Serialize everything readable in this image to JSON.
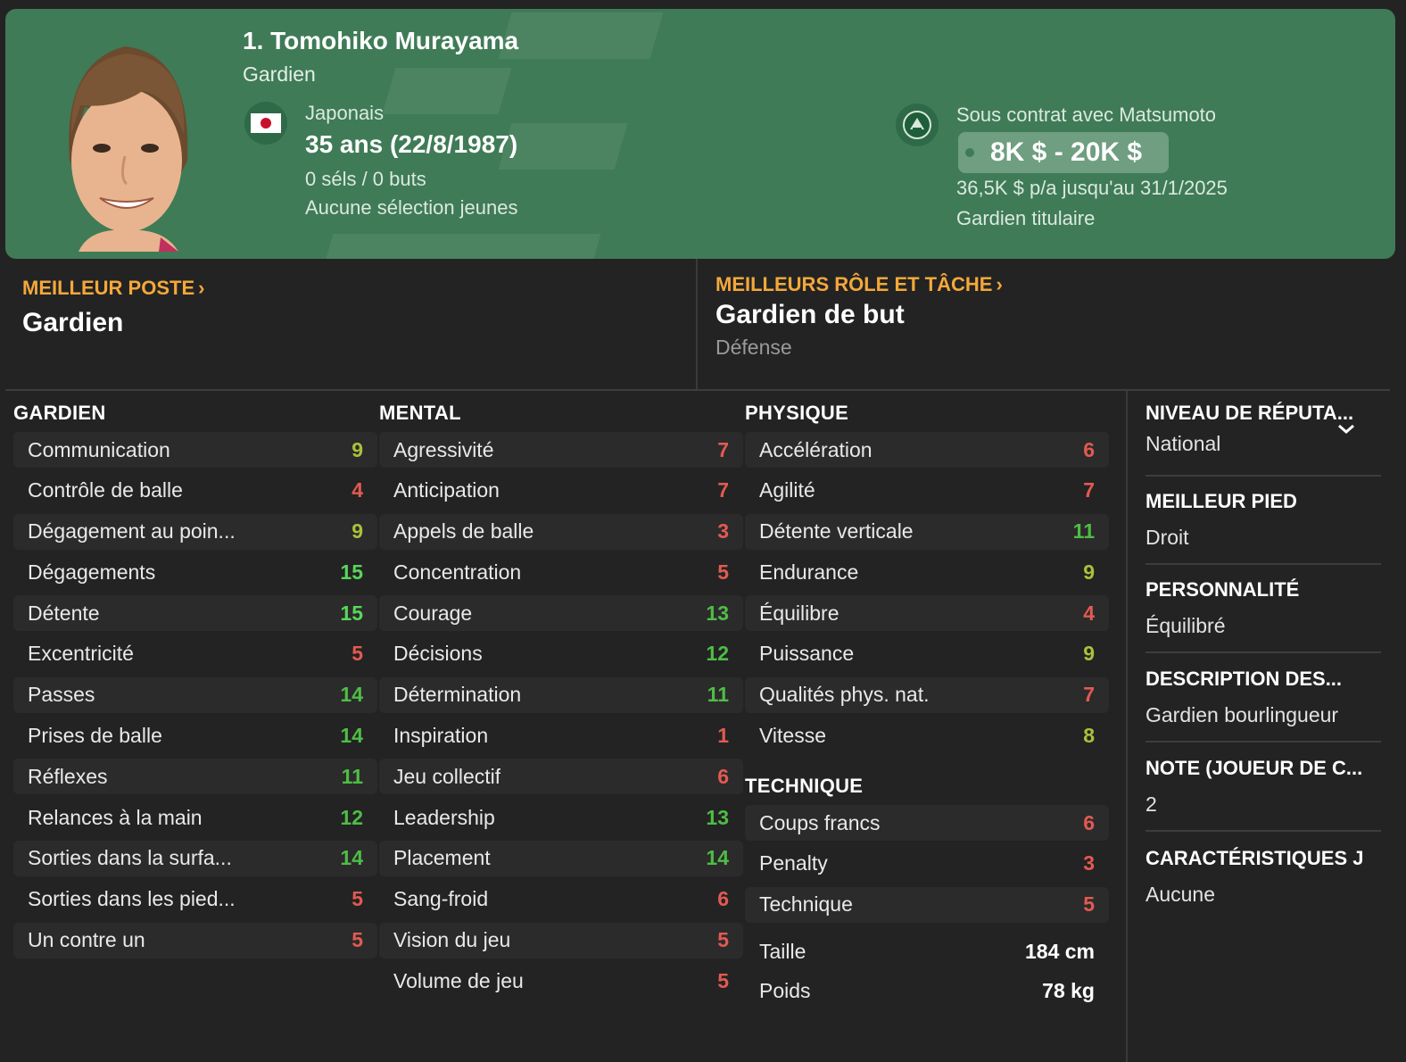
{
  "header": {
    "name": "1. Tomohiko Murayama",
    "position": "Gardien",
    "nationality": "Japonais",
    "age": "35 ans (22/8/1987)",
    "caps": "0 séls / 0 buts",
    "youth": "Aucune sélection jeunes",
    "contract": "Sous contrat avec Matsumoto",
    "wage_range": "8K $ - 20K $",
    "wage_annual": "36,5K $ p/a jusqu'au 31/1/2025",
    "squad_status": "Gardien titulaire",
    "flag_icon": "japan-flag-icon",
    "club_icon": "matsumoto-badge-icon"
  },
  "best_position": {
    "heading": "MEILLEUR POSTE",
    "value": "Gardien"
  },
  "best_role": {
    "heading": "MEILLEURS RÔLE ET TÂCHE",
    "value": "Gardien de but",
    "duty": "Défense"
  },
  "colors": {
    "header_bg": "#3f7b57",
    "accent": "#f4a83a",
    "low": "#e25a52",
    "mid": "#a9c23a",
    "good": "#4fbd45",
    "high": "#58d65a"
  },
  "goalkeeping": {
    "title": "GARDIEN",
    "rows": [
      {
        "name": "Communication",
        "value": "9",
        "tier": "olive"
      },
      {
        "name": "Contrôle de balle",
        "value": "4",
        "tier": "red"
      },
      {
        "name": "Dégagement au poin...",
        "value": "9",
        "tier": "olive"
      },
      {
        "name": "Dégagements",
        "value": "15",
        "tier": "bright"
      },
      {
        "name": "Détente",
        "value": "15",
        "tier": "bright"
      },
      {
        "name": "Excentricité",
        "value": "5",
        "tier": "red"
      },
      {
        "name": "Passes",
        "value": "14",
        "tier": "green"
      },
      {
        "name": "Prises de balle",
        "value": "14",
        "tier": "green"
      },
      {
        "name": "Réflexes",
        "value": "11",
        "tier": "green"
      },
      {
        "name": "Relances à la main",
        "value": "12",
        "tier": "green"
      },
      {
        "name": "Sorties dans la surfa...",
        "value": "14",
        "tier": "green"
      },
      {
        "name": "Sorties dans les pied...",
        "value": "5",
        "tier": "red"
      },
      {
        "name": "Un contre un",
        "value": "5",
        "tier": "red"
      }
    ]
  },
  "mental": {
    "title": "MENTAL",
    "rows": [
      {
        "name": "Agressivité",
        "value": "7",
        "tier": "red"
      },
      {
        "name": "Anticipation",
        "value": "7",
        "tier": "red"
      },
      {
        "name": "Appels de balle",
        "value": "3",
        "tier": "red"
      },
      {
        "name": "Concentration",
        "value": "5",
        "tier": "red"
      },
      {
        "name": "Courage",
        "value": "13",
        "tier": "green"
      },
      {
        "name": "Décisions",
        "value": "12",
        "tier": "green"
      },
      {
        "name": "Détermination",
        "value": "11",
        "tier": "green"
      },
      {
        "name": "Inspiration",
        "value": "1",
        "tier": "red"
      },
      {
        "name": "Jeu collectif",
        "value": "6",
        "tier": "red"
      },
      {
        "name": "Leadership",
        "value": "13",
        "tier": "green"
      },
      {
        "name": "Placement",
        "value": "14",
        "tier": "green"
      },
      {
        "name": "Sang-froid",
        "value": "6",
        "tier": "red"
      },
      {
        "name": "Vision du jeu",
        "value": "5",
        "tier": "red"
      },
      {
        "name": "Volume de jeu",
        "value": "5",
        "tier": "red"
      }
    ]
  },
  "physical": {
    "title": "PHYSIQUE",
    "rows": [
      {
        "name": "Accélération",
        "value": "6",
        "tier": "red"
      },
      {
        "name": "Agilité",
        "value": "7",
        "tier": "red"
      },
      {
        "name": "Détente verticale",
        "value": "11",
        "tier": "green"
      },
      {
        "name": "Endurance",
        "value": "9",
        "tier": "olive"
      },
      {
        "name": "Équilibre",
        "value": "4",
        "tier": "red"
      },
      {
        "name": "Puissance",
        "value": "9",
        "tier": "olive"
      },
      {
        "name": "Qualités phys. nat.",
        "value": "7",
        "tier": "red"
      },
      {
        "name": "Vitesse",
        "value": "8",
        "tier": "olive"
      }
    ]
  },
  "technical": {
    "title": "TECHNIQUE",
    "rows": [
      {
        "name": "Coups francs",
        "value": "6",
        "tier": "red"
      },
      {
        "name": "Penalty",
        "value": "3",
        "tier": "red"
      },
      {
        "name": "Technique",
        "value": "5",
        "tier": "red"
      }
    ]
  },
  "measures": [
    {
      "name": "Taille",
      "value": "184 cm"
    },
    {
      "name": "Poids",
      "value": "78 kg"
    }
  ],
  "info": [
    {
      "title": "NIVEAU DE RÉPUTA...",
      "value": "National"
    },
    {
      "title": "MEILLEUR PIED",
      "value": "Droit"
    },
    {
      "title": "PERSONNALITÉ",
      "value": "Équilibré"
    },
    {
      "title": "DESCRIPTION DES...",
      "value": "Gardien bourlingueur"
    },
    {
      "title": "NOTE (JOUEUR DE C...",
      "value": "2"
    },
    {
      "title": "CARACTÉRISTIQUES J",
      "value": "Aucune"
    }
  ]
}
